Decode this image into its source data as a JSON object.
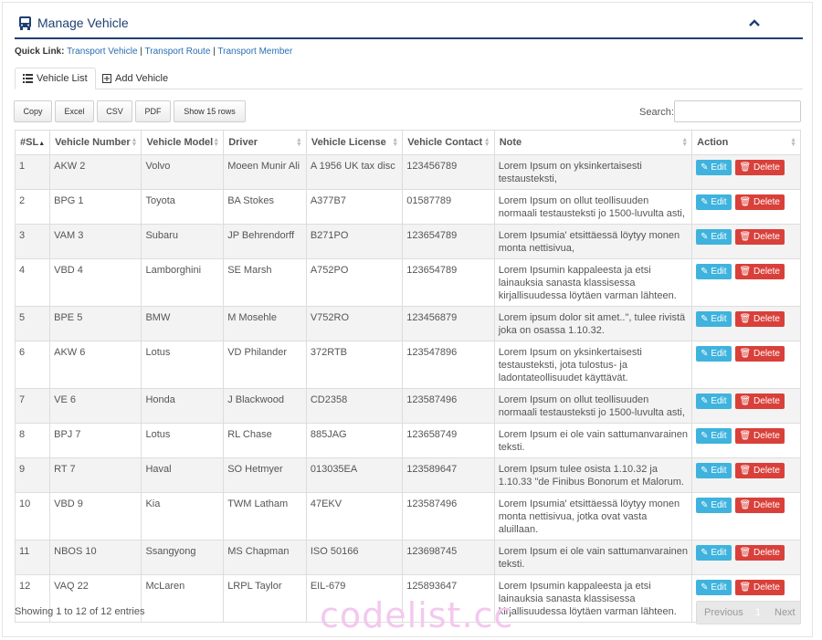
{
  "header": {
    "title": "Manage Vehicle",
    "icon": "bus-icon",
    "collapse_icon": "chevron-up-icon",
    "accent": "#1f3f72"
  },
  "quick_link": {
    "label": "Quick Link:",
    "links": [
      "Transport Vehicle",
      "Transport Route",
      "Transport Member"
    ],
    "separator": "|"
  },
  "tabs": [
    {
      "label": "Vehicle List",
      "icon": "list-icon"
    },
    {
      "label": "Add Vehicle",
      "icon": "plus-square-icon"
    }
  ],
  "toolbar": {
    "copy": "Copy",
    "excel": "Excel",
    "csv": "CSV",
    "pdf": "PDF",
    "show": "Show 15 rows",
    "search_label": "Search:",
    "search_value": ""
  },
  "table": {
    "columns": [
      "#SL",
      "Vehicle Number",
      "Vehicle Model",
      "Driver",
      "Vehicle License",
      "Vehicle Contact",
      "Note",
      "Action"
    ],
    "edit_label": "Edit",
    "delete_label": "Delete",
    "rows": [
      [
        "1",
        "AKW 2",
        "Volvo",
        "Moeen Munir Ali",
        "A 1956 UK tax disc",
        "123456789",
        "Lorem Ipsum on yksinkertaisesti testausteksti,"
      ],
      [
        "2",
        "BPG 1",
        "Toyota",
        "BA Stokes",
        "A377B7",
        "01587789",
        "Lorem Ipsum on ollut teollisuuden normaali testausteksti jo 1500-luvulta asti,"
      ],
      [
        "3",
        "VAM 3",
        "Subaru",
        "JP Behrendorff",
        "B271PO",
        "123654789",
        "Lorem Ipsumia' etsittäessä löytyy monen monta nettisivua,"
      ],
      [
        "4",
        "VBD 4",
        "Lamborghini",
        "SE Marsh",
        "A752PO",
        "123654789",
        "Lorem Ipsumin kappaleesta ja etsi lainauksia sanasta klassisessa kirjallisuudessa löytäen varman lähteen."
      ],
      [
        "5",
        "BPE 5",
        "BMW",
        "M Mosehle",
        "V752RO",
        "123456879",
        "Lorem ipsum dolor sit amet..\", tulee rivistä joka on osassa 1.10.32."
      ],
      [
        "6",
        "AKW 6",
        "Lotus",
        "VD Philander",
        "372RTB",
        "123547896",
        "Lorem Ipsum on yksinkertaisesti testausteksti, jota tulostus- ja ladontateollisuudet käyttävät."
      ],
      [
        "7",
        "VE 6",
        "Honda",
        "J Blackwood",
        "CD2358",
        "123587496",
        "Lorem Ipsum on ollut teollisuuden normaali testausteksti jo 1500-luvulta asti,"
      ],
      [
        "8",
        "BPJ 7",
        "Lotus",
        "RL Chase",
        "885JAG",
        "123658749",
        "Lorem Ipsum ei ole vain sattumanvarainen teksti."
      ],
      [
        "9",
        "RT 7",
        "Haval",
        "SO Hetmyer",
        "013035EA",
        "123589647",
        "Lorem Ipsum tulee osista 1.10.32 ja 1.10.33 \"de Finibus Bonorum et Malorum."
      ],
      [
        "10",
        "VBD 9",
        "Kia",
        "TWM Latham",
        "47EKV",
        "123587496",
        "Lorem Ipsumia' etsittäessä löytyy monen monta nettisivua, jotka ovat vasta aluillaan."
      ],
      [
        "11",
        "NBOS 10",
        "Ssangyong",
        "MS Chapman",
        "ISO 50166",
        "123698745",
        "Lorem Ipsum ei ole vain sattumanvarainen teksti."
      ],
      [
        "12",
        "VAQ 22",
        "McLaren",
        "LRPL Taylor",
        "EIL-679",
        "125893647",
        "Lorem Ipsumin kappaleesta ja etsi lainauksia sanasta klassisessa kirjallisuudessa löytäen varman lähteen."
      ]
    ]
  },
  "footer": {
    "info": "Showing 1 to 12 of 12 entries",
    "previous": "Previous",
    "page": "1",
    "next": "Next"
  },
  "watermark": "codelist.cc",
  "colors": {
    "edit": "#3fb3dd",
    "delete": "#d9403a",
    "link": "#2a6fb3"
  }
}
